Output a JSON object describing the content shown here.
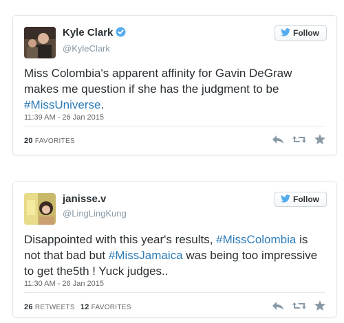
{
  "tweets": [
    {
      "display_name": "Kyle Clark",
      "screen_name": "@KyleClark",
      "verified": true,
      "follow_label": "Follow",
      "text_parts": [
        "Miss Colombia's apparent affinity for Gavin DeGraw makes me question if she has the judgment to be ",
        "#MissUniverse",
        "."
      ],
      "timestamp": "11:39 AM - 26 Jan 2015",
      "favorites_count": "20",
      "favorites_label": "FAVORITES"
    },
    {
      "display_name": "janisse.v",
      "screen_name": "@LingLingKung",
      "verified": false,
      "follow_label": "Follow",
      "text_parts": [
        "Disappointed with this year's results, ",
        "#MissColombia",
        " is not that bad but ",
        "#MissJamaica",
        " was being too impressive to get the5th ! Yuck judges.."
      ],
      "timestamp": "11:30 AM - 26 Jan 2015",
      "retweets_count": "26",
      "retweets_label": "RETWEETS",
      "favorites_count": "12",
      "favorites_label": "FAVORITES"
    }
  ],
  "icons": {
    "twitter_bird": "twitter-bird-icon",
    "verified": "verified-badge-icon",
    "reply": "reply-icon",
    "retweet": "retweet-icon",
    "favorite": "star-icon"
  },
  "colors": {
    "hashtag": "#2b7bb9",
    "twitter_blue": "#55acee",
    "action_gray": "#8899a6"
  }
}
